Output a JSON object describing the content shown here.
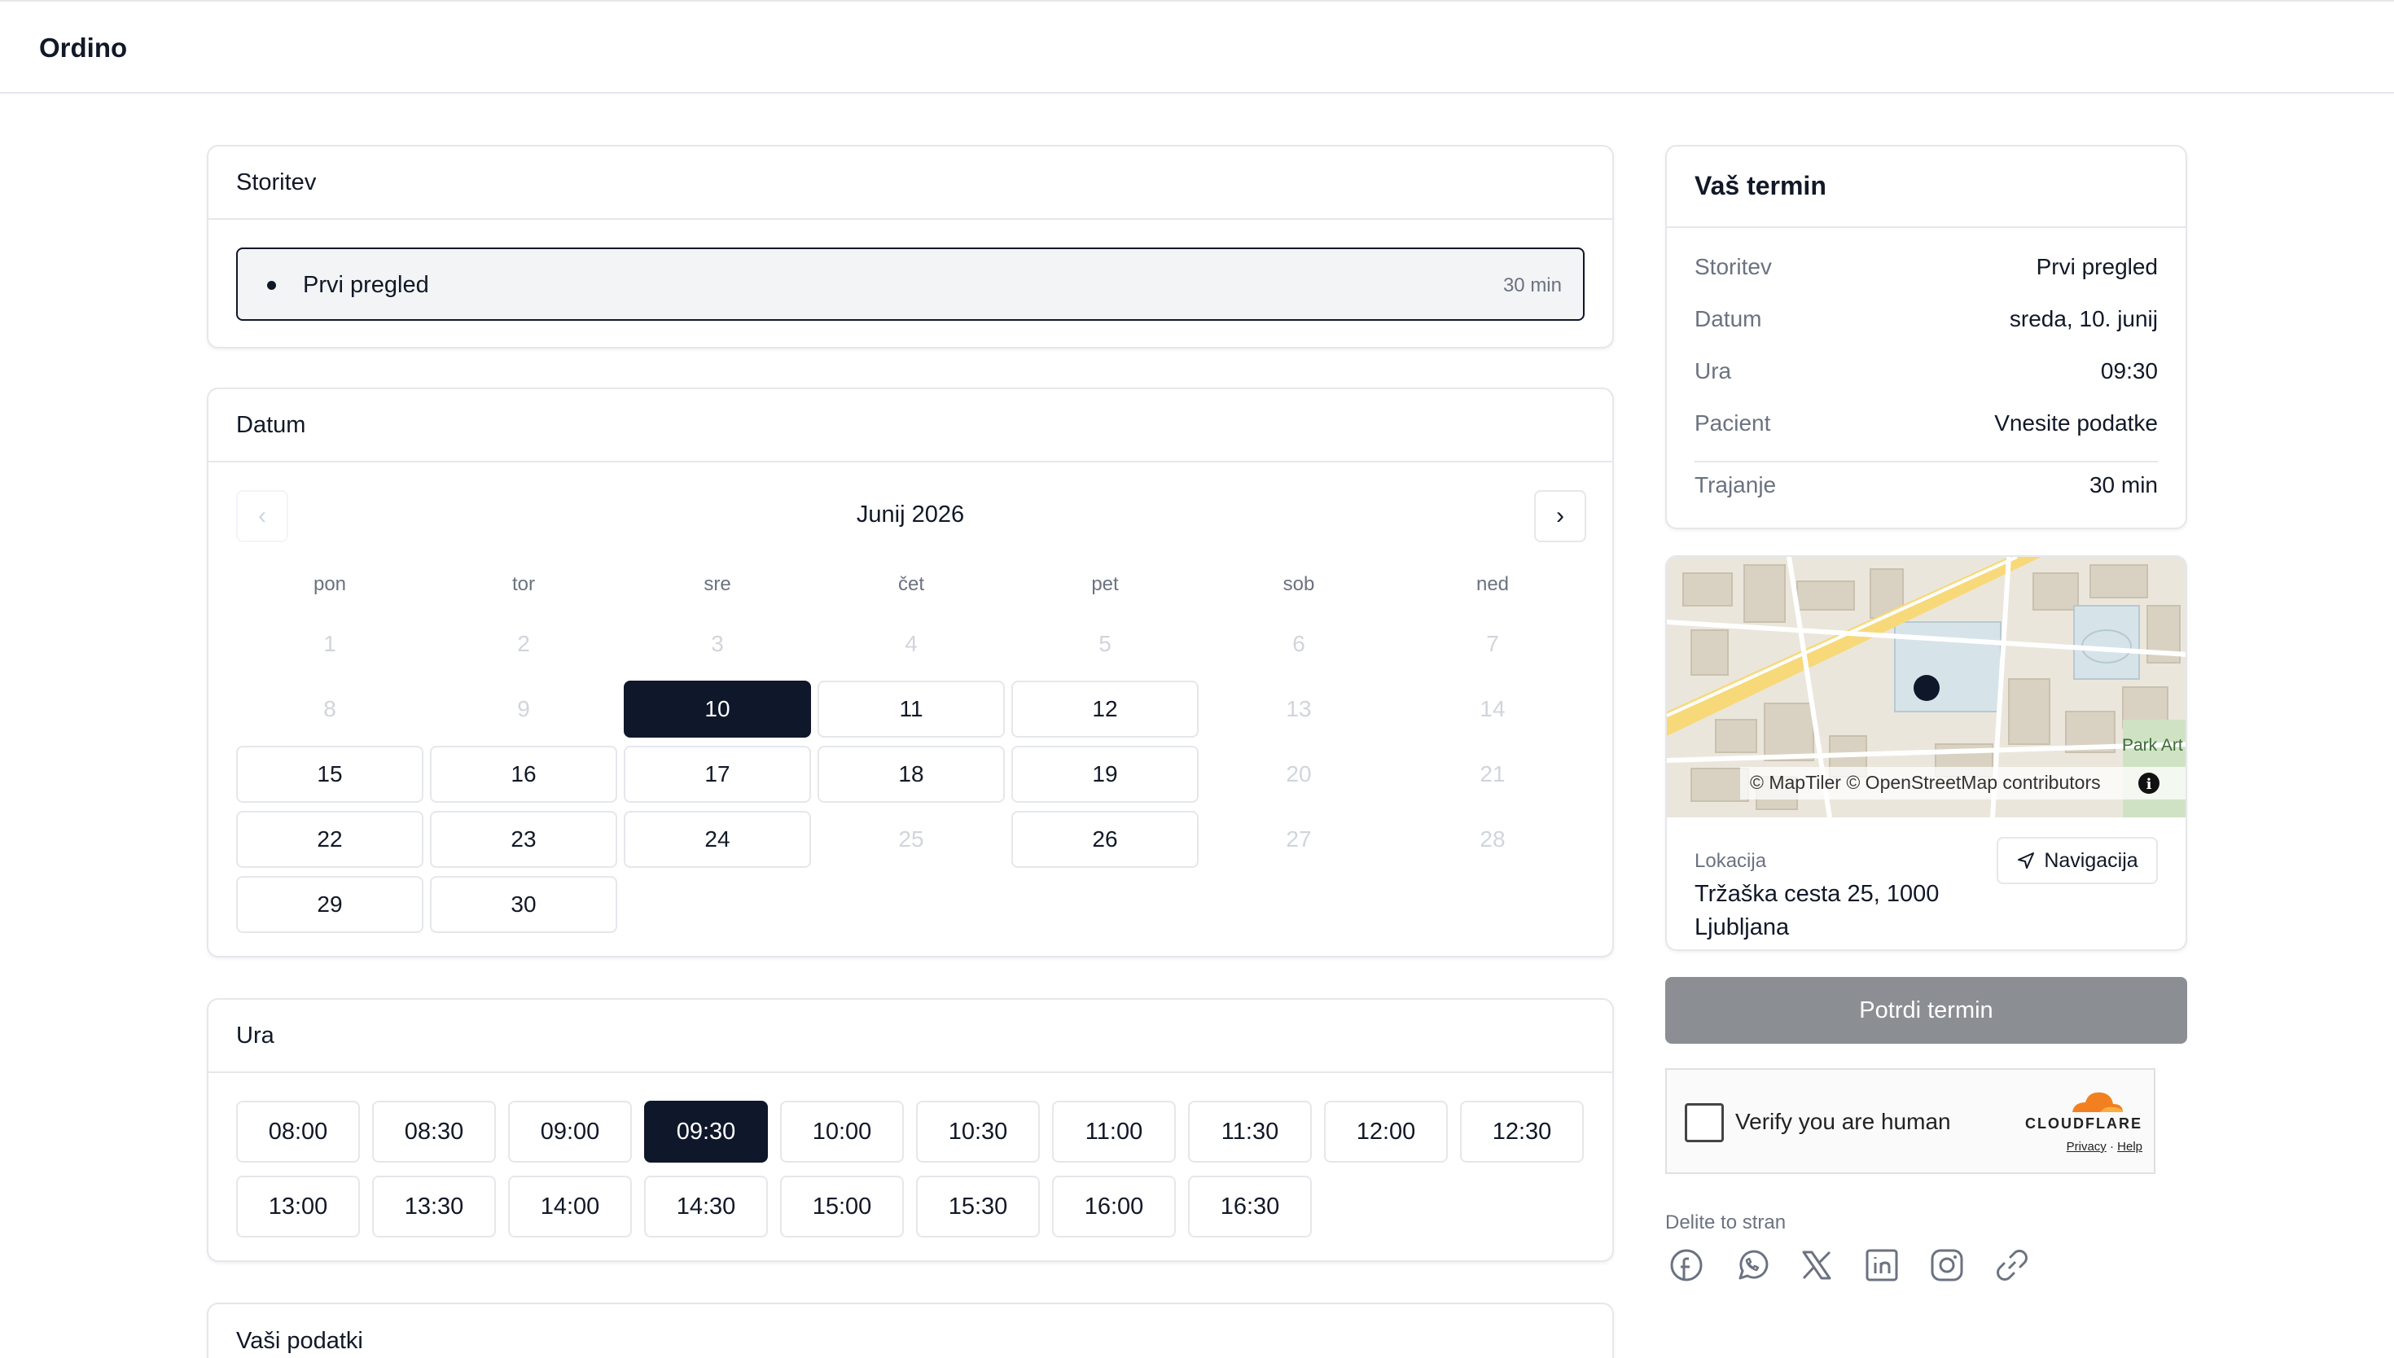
{
  "brand": "Ordino",
  "service": {
    "header": "Storitev",
    "items": [
      {
        "name": "Prvi pregled",
        "duration": "30 min"
      }
    ]
  },
  "calendar": {
    "header": "Datum",
    "month": "Junij 2026",
    "weekdays": [
      "pon",
      "tor",
      "sre",
      "čet",
      "pet",
      "sob",
      "ned"
    ],
    "days": [
      {
        "d": "1",
        "s": "disabled"
      },
      {
        "d": "2",
        "s": "disabled"
      },
      {
        "d": "3",
        "s": "disabled"
      },
      {
        "d": "4",
        "s": "disabled"
      },
      {
        "d": "5",
        "s": "disabled"
      },
      {
        "d": "6",
        "s": "disabled"
      },
      {
        "d": "7",
        "s": "disabled"
      },
      {
        "d": "8",
        "s": "disabled"
      },
      {
        "d": "9",
        "s": "disabled"
      },
      {
        "d": "10",
        "s": "selected"
      },
      {
        "d": "11",
        "s": "avail"
      },
      {
        "d": "12",
        "s": "avail"
      },
      {
        "d": "13",
        "s": "disabled"
      },
      {
        "d": "14",
        "s": "disabled"
      },
      {
        "d": "15",
        "s": "avail"
      },
      {
        "d": "16",
        "s": "avail"
      },
      {
        "d": "17",
        "s": "avail"
      },
      {
        "d": "18",
        "s": "avail"
      },
      {
        "d": "19",
        "s": "avail"
      },
      {
        "d": "20",
        "s": "disabled"
      },
      {
        "d": "21",
        "s": "disabled"
      },
      {
        "d": "22",
        "s": "avail"
      },
      {
        "d": "23",
        "s": "avail"
      },
      {
        "d": "24",
        "s": "avail"
      },
      {
        "d": "25",
        "s": "disabled"
      },
      {
        "d": "26",
        "s": "avail"
      },
      {
        "d": "27",
        "s": "disabled"
      },
      {
        "d": "28",
        "s": "disabled"
      },
      {
        "d": "29",
        "s": "avail"
      },
      {
        "d": "30",
        "s": "avail"
      }
    ]
  },
  "time": {
    "header": "Ura",
    "slots": [
      "08:00",
      "08:30",
      "09:00",
      "09:30",
      "10:00",
      "10:30",
      "11:00",
      "11:30",
      "12:00",
      "12:30",
      "13:00",
      "13:30",
      "14:00",
      "14:30",
      "15:00",
      "15:30",
      "16:00",
      "16:30"
    ],
    "selected": "09:30"
  },
  "details": {
    "header": "Vaši podatki"
  },
  "summary": {
    "title": "Vaš termin",
    "rows": [
      {
        "k": "Storitev",
        "v": "Prvi pregled"
      },
      {
        "k": "Datum",
        "v": "sreda, 10. junij"
      },
      {
        "k": "Ura",
        "v": "09:30"
      },
      {
        "k": "Pacient",
        "v": "Vnesite podatke"
      },
      {
        "k": "Trajanje",
        "v": "30 min"
      }
    ]
  },
  "map": {
    "attribution": "© MapTiler © OpenStreetMap contributors",
    "park_label": "Park Art",
    "location_label": "Lokacija",
    "address": "Tržaška cesta 25, 1000 Ljubljana",
    "navigation": "Navigacija"
  },
  "confirm_label": "Potrdi termin",
  "captcha": {
    "text": "Verify you are human",
    "brand": "CLOUDFLARE",
    "privacy": "Privacy",
    "help": "Help"
  },
  "share": {
    "label": "Delite to stran",
    "icons": [
      "facebook-icon",
      "whatsapp-icon",
      "x-icon",
      "linkedin-icon",
      "instagram-icon",
      "link-icon"
    ]
  },
  "colors": {
    "accent": "#0f172a",
    "disabled_button": "#8b8e93",
    "border": "#e5e7eb",
    "muted_text": "#6b7280"
  }
}
